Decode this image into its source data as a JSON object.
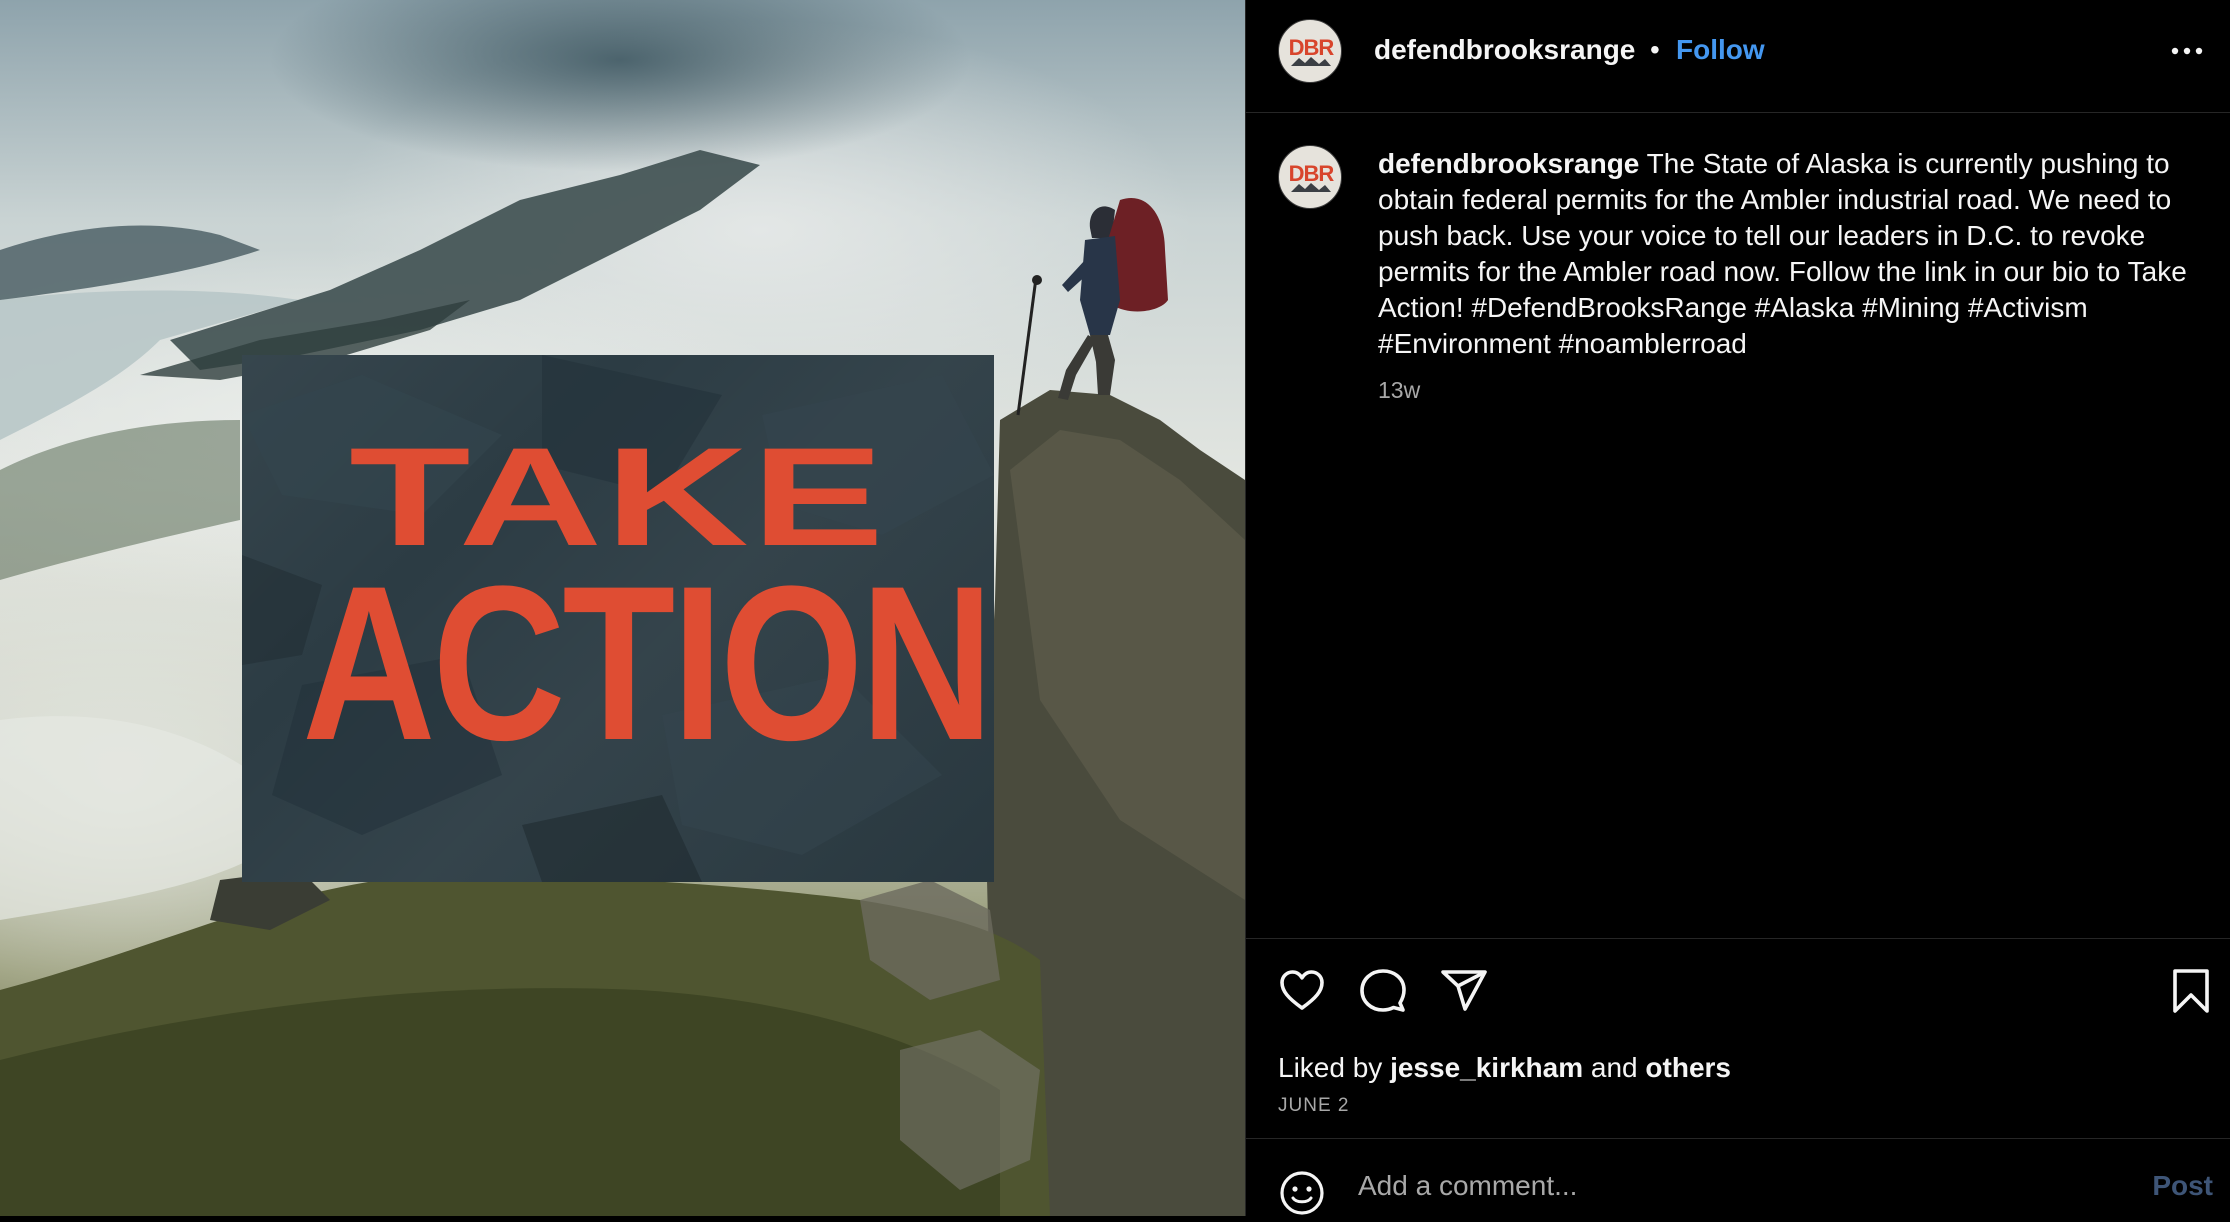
{
  "post": {
    "username": "defendbrooksrange",
    "avatar_text": "DBR",
    "separator": "•",
    "follow_label": "Follow",
    "caption_text": "The State of Alaska is currently pushing to obtain federal permits for the Ambler industrial road. We need to push back. Use your voice to tell our leaders in D.C. to revoke permits for the Ambler road now. Follow the link in our bio to Take Action! #DefendBrooksRange #Alaska #Mining #Activism #Environment #noamblerroad",
    "time_ago": "13w",
    "date": "JUNE 2"
  },
  "media": {
    "overlay_line1": "TAKE",
    "overlay_line2": "ACTION"
  },
  "likes": {
    "prefix": "Liked by",
    "user": "jesse_kirkham",
    "joiner": "and",
    "others": "others"
  },
  "comment": {
    "placeholder": "Add a comment...",
    "post_label": "Post"
  },
  "colors": {
    "accent_link": "#4497f0",
    "overlay_text": "#df4d33",
    "overlay_card": "#2c3c44"
  },
  "icons": [
    "more-icon",
    "heart-icon",
    "comment-icon",
    "share-icon",
    "bookmark-icon",
    "emoji-icon"
  ]
}
